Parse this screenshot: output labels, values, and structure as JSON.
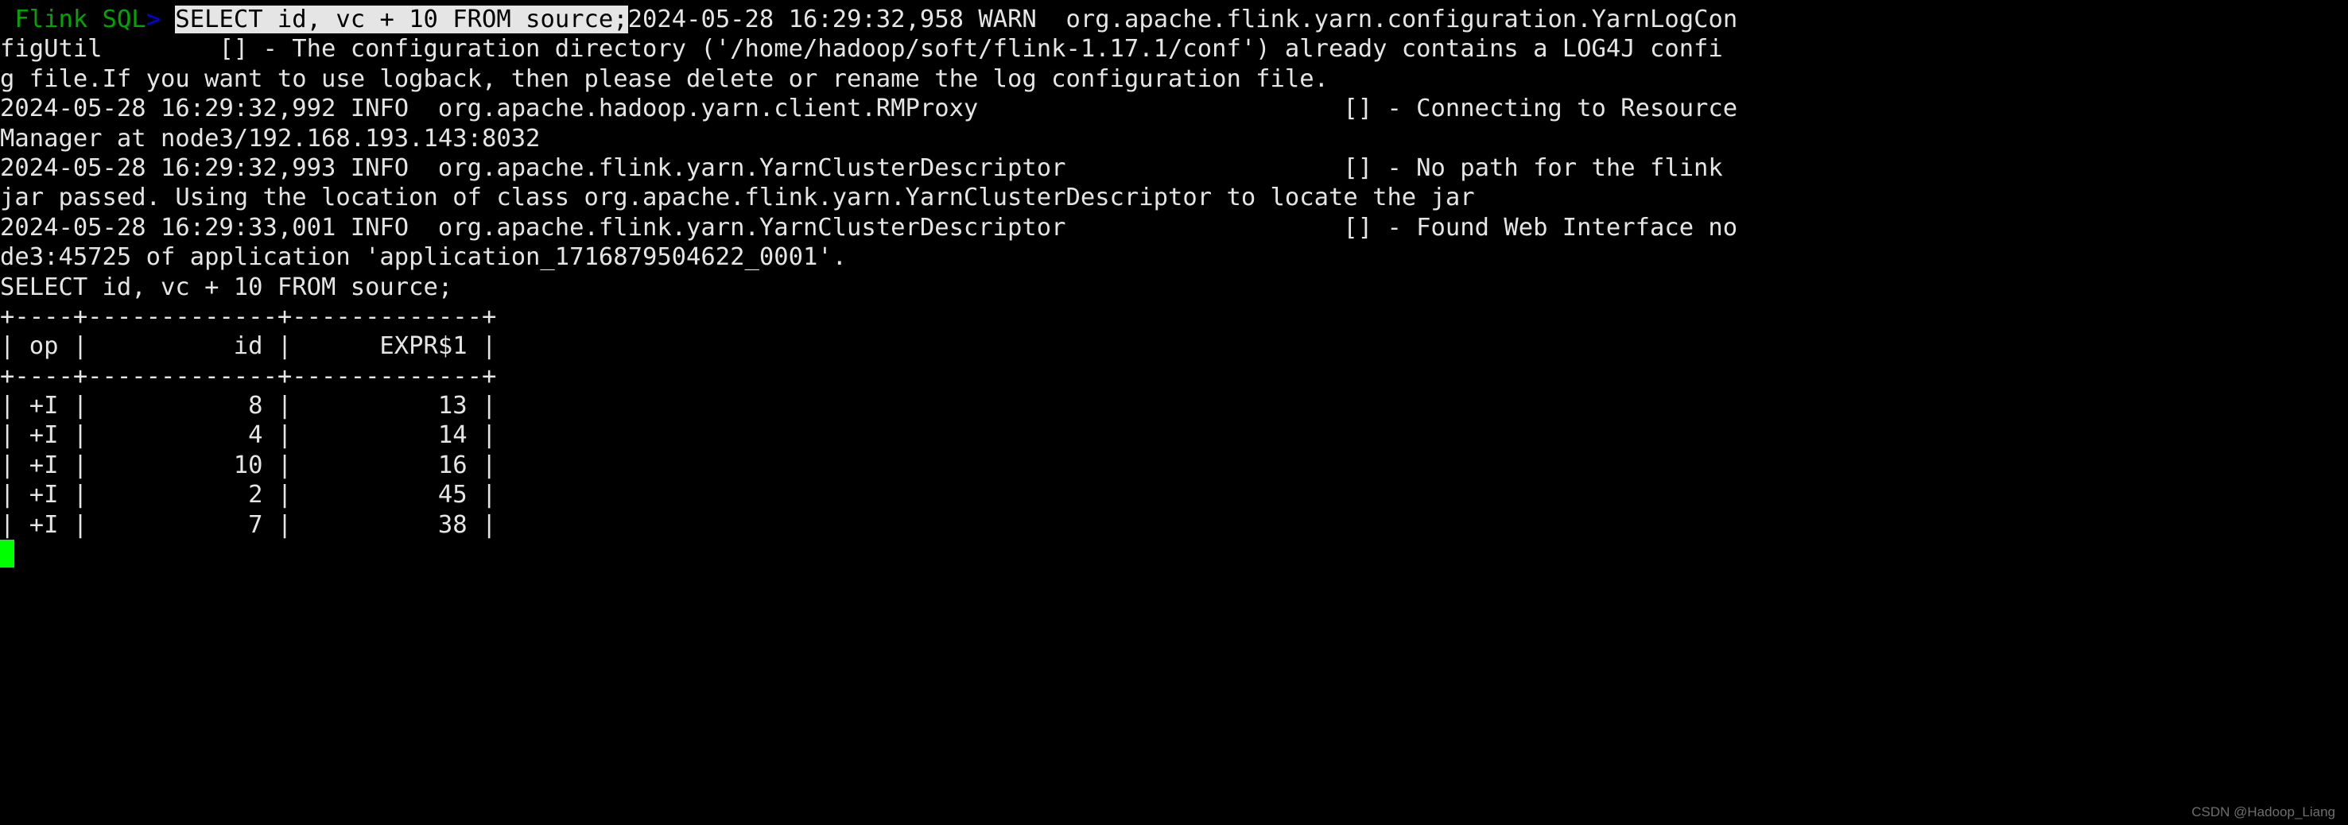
{
  "terminal": {
    "background_color": "#000000",
    "foreground_color": "#e5e5e5",
    "prompt": {
      "app_name": "Flink SQL",
      "app_name_color": "#00a600",
      "chevron": ">",
      "chevron_color": "#0000ee"
    },
    "selection": {
      "text": "SELECT id, vc + 10 FROM source;",
      "background_color": "#e5e5e5",
      "foreground_color": "#000000"
    },
    "cursor": {
      "glyph": "block-cursor",
      "color": "#00ff00"
    },
    "lines": [
      {
        "id": "line-1-prompt",
        "parts": [
          {
            "text": " ",
            "style": "plain"
          },
          {
            "text": "Flink SQL",
            "style": "green"
          },
          {
            "text": ">",
            "style": "blue"
          },
          {
            "text": " ",
            "style": "plain"
          },
          {
            "text": "SELECT id, vc + 10 FROM source;",
            "style": "selected"
          },
          {
            "text": "2024-05-28 16:29:32,958 WARN  org.apache.flink.yarn.configuration.YarnLogCon",
            "style": "plain"
          }
        ]
      },
      {
        "id": "line-2",
        "text": "figUtil        [] - The configuration directory ('/home/hadoop/soft/flink-1.17.1/conf') already contains a LOG4J confi"
      },
      {
        "id": "line-3",
        "text": "g file.If you want to use logback, then please delete or rename the log configuration file."
      },
      {
        "id": "line-4",
        "text": "2024-05-28 16:29:32,992 INFO  org.apache.hadoop.yarn.client.RMProxy                         [] - Connecting to Resource"
      },
      {
        "id": "line-5",
        "text": "Manager at node3/192.168.193.143:8032"
      },
      {
        "id": "line-6",
        "text": "2024-05-28 16:29:32,993 INFO  org.apache.flink.yarn.YarnClusterDescriptor                   [] - No path for the flink"
      },
      {
        "id": "line-7",
        "text": "jar passed. Using the location of class org.apache.flink.yarn.YarnClusterDescriptor to locate the jar"
      },
      {
        "id": "line-8",
        "text": "2024-05-28 16:29:33,001 INFO  org.apache.flink.yarn.YarnClusterDescriptor                   [] - Found Web Interface no"
      },
      {
        "id": "line-9",
        "text": "de3:45725 of application 'application_1716879504622_0001'."
      },
      {
        "id": "line-10-query-echo",
        "text": "SELECT id, vc + 10 FROM source;"
      },
      {
        "id": "line-11-table-top-rule",
        "text": "+----+-------------+-------------+"
      },
      {
        "id": "line-12-table-header",
        "text": "| op |          id |      EXPR$1 |"
      },
      {
        "id": "line-13-table-header-rule",
        "text": "+----+-------------+-------------+"
      },
      {
        "id": "line-14-row-1",
        "text": "| +I |           8 |          13 |"
      },
      {
        "id": "line-15-row-2",
        "text": "| +I |           4 |          14 |"
      },
      {
        "id": "line-16-row-3",
        "text": "| +I |          10 |          16 |"
      },
      {
        "id": "line-17-row-4",
        "text": "| +I |           2 |          45 |"
      },
      {
        "id": "line-18-row-5",
        "text": "| +I |           7 |          38 |"
      }
    ],
    "result_table": {
      "columns": [
        "op",
        "id",
        "EXPR$1"
      ],
      "rows": [
        [
          "+I",
          "8",
          "13"
        ],
        [
          "+I",
          "4",
          "14"
        ],
        [
          "+I",
          "10",
          "16"
        ],
        [
          "+I",
          "2",
          "45"
        ],
        [
          "+I",
          "7",
          "38"
        ]
      ]
    }
  },
  "watermark": {
    "text": "CSDN @Hadoop_Liang"
  }
}
